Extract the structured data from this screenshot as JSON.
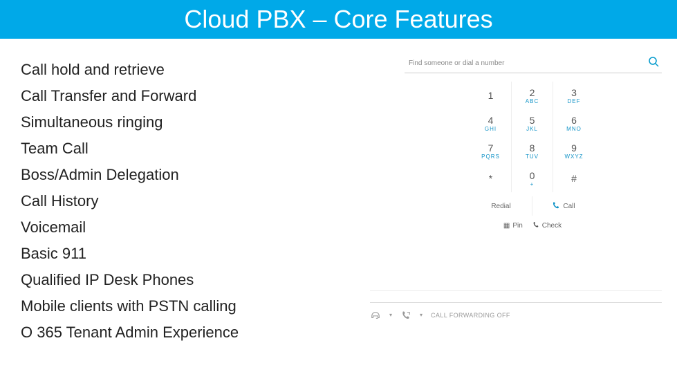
{
  "title": "Cloud PBX – Core Features",
  "features": [
    "Call hold and retrieve",
    "Call Transfer and Forward",
    "Simultaneous ringing",
    "Team Call",
    "Boss/Admin Delegation",
    "Call History",
    "Voicemail",
    "Basic 911",
    "Qualified IP Desk Phones",
    "Mobile clients with PSTN calling",
    "O 365 Tenant Admin Experience"
  ],
  "app": {
    "search_placeholder": "Find someone or dial a number",
    "dialpad": [
      {
        "num": "1",
        "sub": ""
      },
      {
        "num": "2",
        "sub": "ABC"
      },
      {
        "num": "3",
        "sub": "DEF"
      },
      {
        "num": "4",
        "sub": "GHI"
      },
      {
        "num": "5",
        "sub": "JKL"
      },
      {
        "num": "6",
        "sub": "MNO"
      },
      {
        "num": "7",
        "sub": "PQRS"
      },
      {
        "num": "8",
        "sub": "TUV"
      },
      {
        "num": "9",
        "sub": "WXYZ"
      },
      {
        "num": "*",
        "sub": ""
      },
      {
        "num": "0",
        "sub": "+"
      },
      {
        "num": "#",
        "sub": ""
      }
    ],
    "redial_label": "Redial",
    "call_label": "Call",
    "pin_label": "Pin",
    "check_label": "Check",
    "cf_label": "CALL FORWARDING OFF"
  }
}
